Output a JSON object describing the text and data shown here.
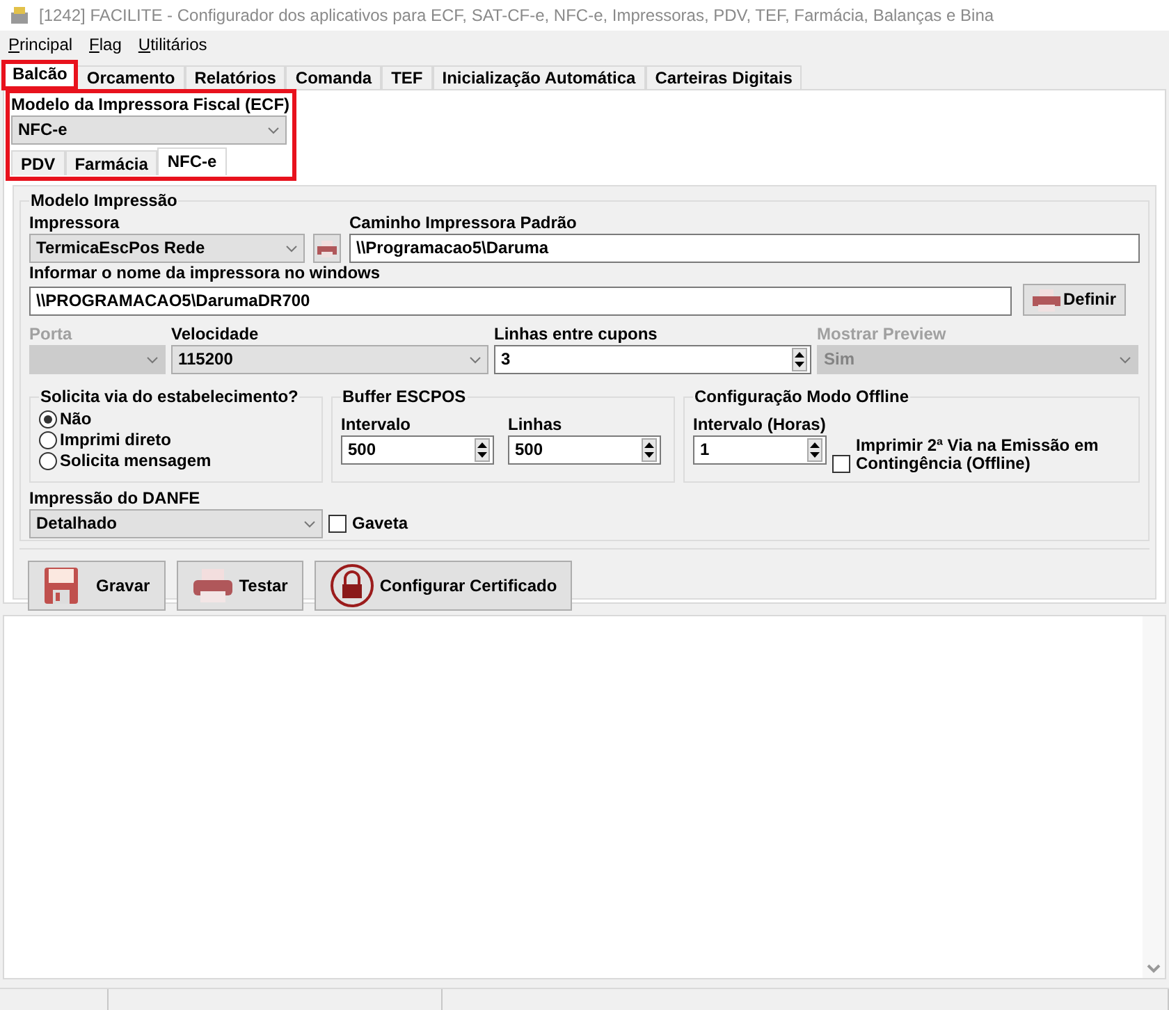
{
  "window": {
    "title": "[1242] FACILITE - Configurador dos aplicativos para ECF, SAT-CF-e, NFC-e, Impressoras, PDV, TEF, Farmácia, Balanças e Bina"
  },
  "menu": [
    "Principal",
    "Flag",
    "Utilitários"
  ],
  "tabs": [
    {
      "label": "Balcão",
      "selected": true,
      "highlighted": true
    },
    {
      "label": "Orcamento",
      "selected": false,
      "highlighted": false
    },
    {
      "label": "Relatórios",
      "selected": false,
      "highlighted": false
    },
    {
      "label": "Comanda",
      "selected": false,
      "highlighted": false
    },
    {
      "label": "TEF",
      "selected": false,
      "highlighted": false
    },
    {
      "label": "Inicialização Automática",
      "selected": false,
      "highlighted": false
    },
    {
      "label": "Carteiras Digitais",
      "selected": false,
      "highlighted": false
    }
  ],
  "fiscal_model": {
    "highlighted": true,
    "label": "Modelo da Impressora Fiscal (ECF)",
    "value": "NFC-e",
    "subtabs": [
      {
        "label": "PDV",
        "selected": false
      },
      {
        "label": "Farmácia",
        "selected": false
      },
      {
        "label": "NFC-e",
        "selected": true
      }
    ]
  },
  "print_model": {
    "title": "Modelo Impressão",
    "printer": {
      "label": "Impressora",
      "value": "TermicaEscPos Rede"
    },
    "default_path": {
      "label": "Caminho Impressora Padrão",
      "value": "\\\\Programacao5\\Daruma"
    },
    "windows_printer": {
      "label": "Informar o nome da impressora no windows",
      "value": "\\\\PROGRAMACAO5\\DarumaDR700",
      "button": "Definir"
    },
    "row_fields": [
      {
        "kind": "select",
        "label": "Porta",
        "disabled": true
      },
      {
        "kind": "select",
        "label": "Velocidade",
        "value": "115200",
        "disabled": false
      },
      {
        "kind": "spin",
        "label": "Linhas entre cupons",
        "value": "3",
        "disabled": false
      },
      {
        "kind": "select",
        "label": "Mostrar Preview",
        "value": "Sim",
        "disabled": true
      }
    ],
    "via_group": {
      "title": "Solicita via do estabelecimento?",
      "options": [
        {
          "label": "Não",
          "selected": true
        },
        {
          "label": "Imprimi direto",
          "selected": false
        },
        {
          "label": "Solicita mensagem",
          "selected": false
        }
      ]
    },
    "buffer_group": {
      "title": "Buffer ESCPOS",
      "fields": [
        {
          "label": "Intervalo",
          "value": "500"
        },
        {
          "label": "Linhas",
          "value": "500"
        }
      ]
    },
    "offline_group": {
      "title": "Configuração Modo Offline",
      "field": {
        "label": "Intervalo (Horas)",
        "value": "1"
      },
      "checkbox": {
        "label": "Imprimir 2ª Via na Emissão em Contingência (Offline)",
        "checked": false
      }
    },
    "danfe": {
      "label": "Impressão do DANFE",
      "value": "Detalhado"
    },
    "drawer": {
      "label": "Gaveta",
      "checked": false
    }
  },
  "actions": [
    {
      "kind": "save",
      "label": "Gravar"
    },
    {
      "kind": "print",
      "label": "Testar"
    },
    {
      "kind": "lock",
      "label": "Configurar Certificado"
    }
  ]
}
